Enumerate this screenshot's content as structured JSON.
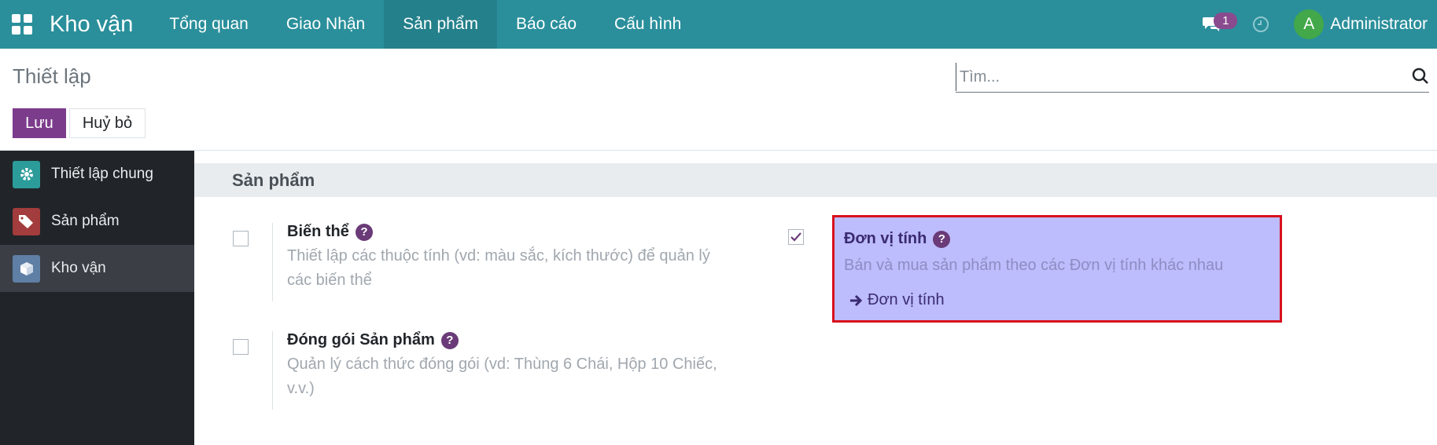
{
  "navbar": {
    "brand": "Kho vận",
    "menu": [
      {
        "label": "Tổng quan"
      },
      {
        "label": "Giao Nhận"
      },
      {
        "label": "Sản phẩm"
      },
      {
        "label": "Báo cáo"
      },
      {
        "label": "Cấu hình"
      }
    ],
    "active_menu": "Sản phẩm",
    "message_count": "1",
    "avatar_letter": "A",
    "username": "Administrator",
    "colors": {
      "background": "#2a8f9b",
      "badge": "#8a4a8e",
      "avatar": "#42a849"
    }
  },
  "control": {
    "title": "Thiết lập",
    "search_placeholder": "Tìm...",
    "save_label": "Lưu",
    "cancel_label": "Huỷ bỏ"
  },
  "sidebar": {
    "items": [
      {
        "label": "Thiết lập chung",
        "icon": "gear-icon",
        "color": "#2b9c9a"
      },
      {
        "label": "Sản phẩm",
        "icon": "tags-icon",
        "color": "#a33c3c"
      },
      {
        "label": "Kho vận",
        "icon": "box-icon",
        "color": "#5f7fa5"
      }
    ],
    "active": "Kho vận"
  },
  "section": {
    "title": "Sản phẩm",
    "settings": [
      {
        "label": "Biến thể",
        "checked": false,
        "description_line1": "Thiết lập các thuộc tính (vd: màu sắc, kích thước) để quản lý",
        "description_line2": "các biến thể"
      },
      {
        "label": "Đóng gói Sản phẩm",
        "checked": false,
        "description_line1": "Quản lý cách thức đóng gói (vd: Thùng 6 Chái, Hộp 10 Chiếc,",
        "description_line2": "v.v.)"
      },
      {
        "label": "Đơn vị tính",
        "checked": true,
        "description": "Bán và mua sản phẩm theo các Đơn vị tính khác nhau",
        "link_label": "Đơn vị tính"
      }
    ]
  }
}
